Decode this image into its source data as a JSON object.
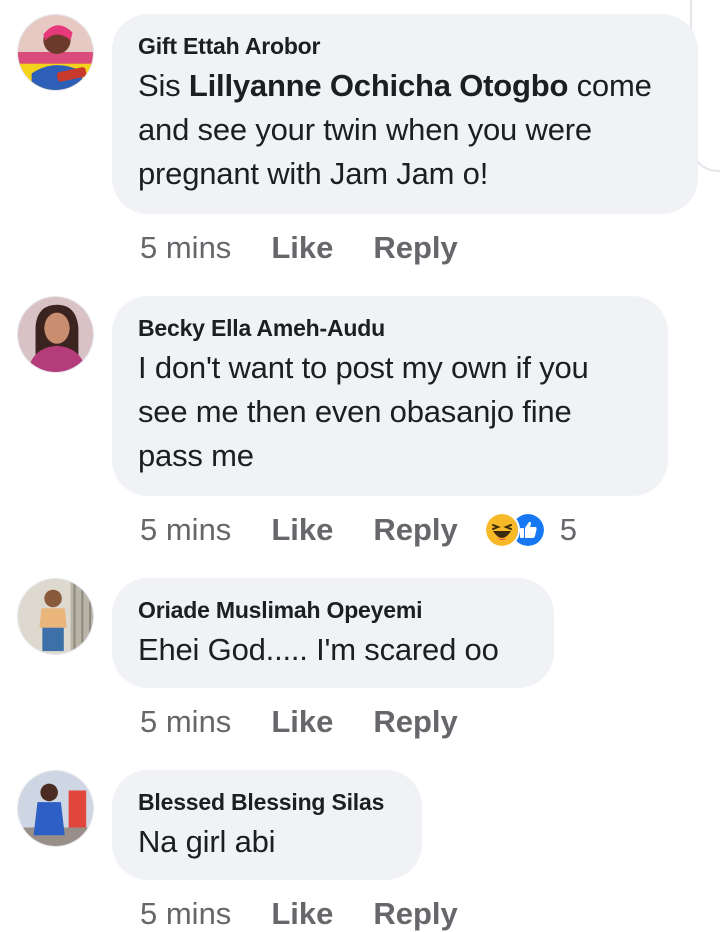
{
  "comments": [
    {
      "author": "Gift Ettah Arobor",
      "text_before": "Sis ",
      "mention": "Lillyanne Ochicha Otogbo",
      "text_after": " come and see your twin when you were pregnant with Jam Jam o!",
      "time": "5 mins",
      "like": "Like",
      "reply": "Reply"
    },
    {
      "author": "Becky Ella Ameh-Audu",
      "text": "I don't want to post my own if you see me then even obasanjo fine pass me",
      "time": "5 mins",
      "like": "Like",
      "reply": "Reply",
      "reactions": {
        "icons": [
          "haha-icon",
          "like-icon"
        ],
        "count": "5"
      }
    },
    {
      "author": "Oriade Muslimah Opeyemi",
      "text": "Ehei God..... I'm scared oo",
      "time": "5 mins",
      "like": "Like",
      "reply": "Reply"
    },
    {
      "author": "Blessed Blessing Silas",
      "text": "Na girl abi",
      "time": "5 mins",
      "like": "Like",
      "reply": "Reply"
    }
  ],
  "colors": {
    "bubble": "#f0f2f5",
    "secondary_text": "#65676b",
    "like_blue": "#1877f2",
    "haha_yellow": "#f7b928"
  }
}
